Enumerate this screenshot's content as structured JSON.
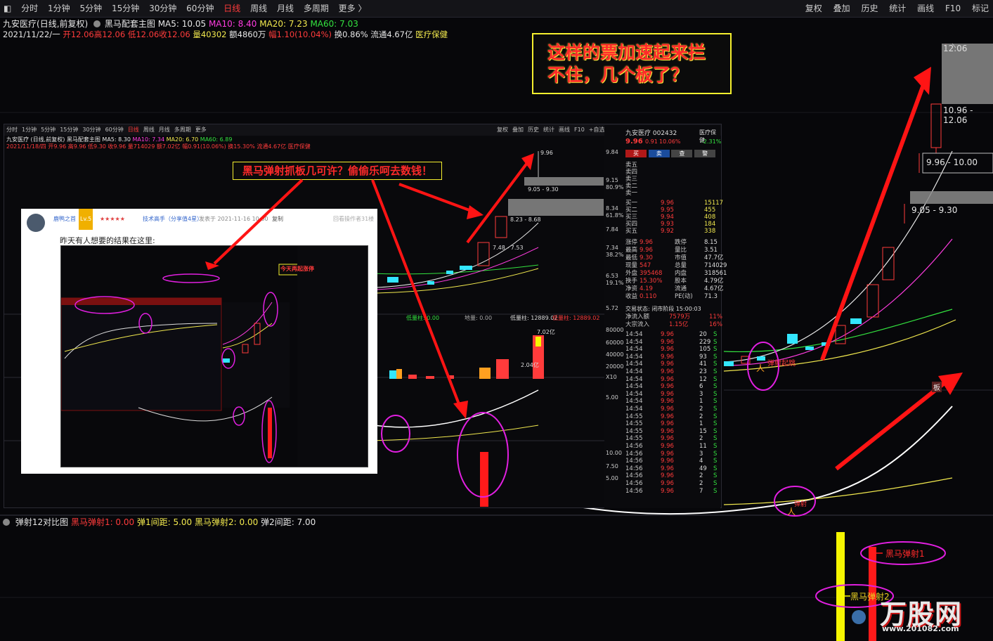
{
  "topbar": {
    "periods": [
      "分时",
      "1分钟",
      "5分钟",
      "15分钟",
      "30分钟",
      "60分钟",
      "日线",
      "周线",
      "月线",
      "多周期",
      "更多 〉"
    ],
    "active_period": "日线",
    "right_tools": [
      "复权",
      "叠加",
      "历史",
      "统计",
      "画线",
      "F10",
      "标记"
    ]
  },
  "header": {
    "stock_name": "九安医疗",
    "stock_mode": "(日线,前复权)",
    "indicator_name": "黑马配套主图",
    "ma5": "MA5: 10.05",
    "ma10": "MA10: 8.40",
    "ma20": "MA20: 7.23",
    "ma60": "MA60: 7.03",
    "date": "2021/11/22/一",
    "open": "开12.06",
    "high": "高12.06",
    "low": "低12.06",
    "close": "收12.06",
    "volume": "量40302",
    "amount": "额4860万",
    "amplitude": "幅1.10(10.04%)",
    "turnover": "换0.86%",
    "float_cap": "流通4.67亿",
    "sector": "医疗保健"
  },
  "callout": {
    "line1": "这样的票加速起来拦",
    "line2": "不住，几个板了？"
  },
  "main_price_labels": {
    "top": "12.06",
    "box1": "10.96 - 12.06",
    "box2": "9.96 - 10.00",
    "box3": "9.05 - 9.30"
  },
  "inner": {
    "periods": [
      "分时",
      "1分钟",
      "5分钟",
      "15分钟",
      "30分钟",
      "60分钟",
      "日线",
      "周线",
      "月线",
      "多周期",
      "更多"
    ],
    "right_tools": [
      "复权",
      "叠加",
      "历史",
      "统计",
      "画线",
      "F10",
      "+自选",
      "返回"
    ],
    "line1_name": "九安医疗 (日线,前复权)",
    "line1_ind": "黑马配套主图",
    "line1_ma5": "MA5: 8.30",
    "line1_ma10": "MA10: 7.34",
    "line1_ma20": "MA20: 6.70",
    "line1_ma60": "MA60: 6.89",
    "line2": "2021/11/18/四 开9.96 高9.96 低9.30 收9.96 量714029 额7.02亿 幅0.91(10.06%) 换15.30% 流通4.67亿 医疗保健",
    "price_top": "9.96",
    "box1": "9.05 - 9.30",
    "box2": "8.23 - 8.68",
    "box3": "7.48 - 7.53",
    "vol_label": "7.02亿",
    "vol_small": "2.04亿",
    "ind_line": "低量柱: 12889.02",
    "ind_line2": "低量柱: 12889.02",
    "ind_left": "低量柱: 0.00",
    "ind_mid": "地量: 0.00"
  },
  "banner": "黑马弹射抓板几可许？偷偷乐呵去数钱！",
  "post": {
    "author": "鹿鸭之首",
    "level": "Lv.5",
    "stars": "★★★★★",
    "tag": "技术高手（分享值4星）",
    "time": "发表于 2021-11-16 10:00",
    "copy": "复制",
    "right": "回看操作者",
    "floor": "31楼",
    "message": "昨天有人想要的结果在这里:",
    "shot_banner": "今天再起涨停"
  },
  "quote": {
    "name": "九安医疗 002432",
    "sector": "医疗保健",
    "price": "9.96",
    "change": "0.91",
    "pct": "10.06%",
    "pct2": "-2.31%",
    "buttons": [
      "买",
      "卖",
      "查",
      "警"
    ],
    "sell_levels": [
      "卖五",
      "卖四",
      "卖三",
      "卖二",
      "卖一"
    ],
    "buy_levels": [
      {
        "label": "买一",
        "price": "9.96",
        "vol": "15117"
      },
      {
        "label": "买二",
        "price": "9.95",
        "vol": "455"
      },
      {
        "label": "买三",
        "price": "9.94",
        "vol": "408"
      },
      {
        "label": "买四",
        "price": "9.93",
        "vol": "184"
      },
      {
        "label": "买五",
        "price": "9.92",
        "vol": "338"
      }
    ],
    "stats": [
      {
        "k": "涨停",
        "v": "9.96",
        "k2": "跌停",
        "v2": "8.15"
      },
      {
        "k": "最高",
        "v": "9.96",
        "k2": "量比",
        "v2": "3.51"
      },
      {
        "k": "最低",
        "v": "9.30",
        "k2": "市值",
        "v2": "47.7亿"
      },
      {
        "k": "现量",
        "v": "547",
        "k2": "总量",
        "v2": "714029"
      },
      {
        "k": "外盘",
        "v": "395468",
        "k2": "内盘",
        "v2": "318561"
      },
      {
        "k": "换手",
        "v": "15.30%",
        "k2": "股本",
        "v2": "4.79亿"
      },
      {
        "k": "净资",
        "v": "4.19",
        "k2": "流通",
        "v2": "4.67亿"
      },
      {
        "k": "收益",
        "v": "0.110",
        "k2": "PE(动)",
        "v2": "71.3"
      }
    ],
    "trade_status": "交易状态: 闭市阶段 15:00:03",
    "net_in": "净流入额",
    "net_in_v": "7579万",
    "net_in_p": "11%",
    "big_in": "大宗流入",
    "big_in_v": "1.15亿",
    "big_in_p": "16%",
    "left_axis": [
      "9.84",
      "9.15",
      "80.9%",
      "8.34",
      "61.8%",
      "7.84",
      "7.34",
      "38.2%",
      "6.53",
      "19.1%",
      "5.72",
      "80000",
      "60000",
      "40000",
      "20000",
      "X10",
      "5.00",
      "10.00",
      "7.50",
      "5.00"
    ],
    "ticks": [
      {
        "t": "14:54",
        "p": "9.96",
        "v": "20"
      },
      {
        "t": "14:54",
        "p": "9.96",
        "v": "229"
      },
      {
        "t": "14:54",
        "p": "9.96",
        "v": "105"
      },
      {
        "t": "14:54",
        "p": "9.96",
        "v": "93"
      },
      {
        "t": "14:54",
        "p": "9.96",
        "v": "41"
      },
      {
        "t": "14:54",
        "p": "9.96",
        "v": "23"
      },
      {
        "t": "14:54",
        "p": "9.96",
        "v": "12"
      },
      {
        "t": "14:54",
        "p": "9.96",
        "v": "6"
      },
      {
        "t": "14:54",
        "p": "9.96",
        "v": "3"
      },
      {
        "t": "14:54",
        "p": "9.96",
        "v": "1"
      },
      {
        "t": "14:54",
        "p": "9.96",
        "v": "2"
      },
      {
        "t": "14:55",
        "p": "9.96",
        "v": "2"
      },
      {
        "t": "14:55",
        "p": "9.96",
        "v": "1"
      },
      {
        "t": "14:55",
        "p": "9.96",
        "v": "15"
      },
      {
        "t": "14:55",
        "p": "9.96",
        "v": "2"
      },
      {
        "t": "14:56",
        "p": "9.96",
        "v": "11"
      },
      {
        "t": "14:56",
        "p": "9.96",
        "v": "3"
      },
      {
        "t": "14:56",
        "p": "9.96",
        "v": "4"
      },
      {
        "t": "14:56",
        "p": "9.96",
        "v": "49"
      },
      {
        "t": "14:56",
        "p": "9.96",
        "v": "2"
      },
      {
        "t": "14:56",
        "p": "9.96",
        "v": "2"
      },
      {
        "t": "14:56",
        "p": "9.96",
        "v": "7"
      }
    ]
  },
  "bottom": {
    "title": "弹射12对比图",
    "s1": "黑马弹射1: 0.00",
    "g1": "弹1间距: 5.00",
    "s2": "黑马弹射2: 0.00",
    "g2": "弹2间距: 7.00",
    "label1": "黑马弹射1",
    "label2": "黑马弹射2"
  },
  "watermark": {
    "text": "万股网",
    "url": "www.201082.com"
  },
  "colors": {
    "up": "#ff3b3b",
    "down": "#33e6ff",
    "ma5": "#e6e6e6",
    "ma10": "#ff3ce0",
    "ma20": "#f2e94e",
    "ma60": "#33e23f",
    "ellipse": "#e11fe0",
    "arrow": "#ff1a1a"
  }
}
